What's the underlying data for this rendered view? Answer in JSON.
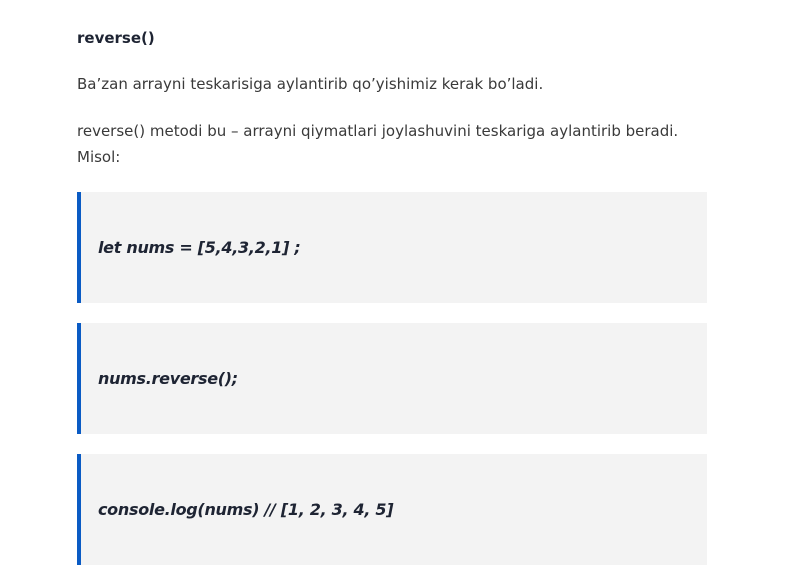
{
  "article": {
    "heading": "reverse()",
    "paragraph_1": "Ba’zan arrayni teskarisiga aylantirib qo’yishimiz kerak bo’ladi.",
    "paragraph_2": "reverse() metodi bu – arrayni qiymatlari joylashuvini teskariga aylantirib beradi. Misol:",
    "code_blocks": [
      "let nums = [5,4,3,2,1] ;",
      "nums.reverse();",
      "console.log(nums) // [1, 2, 3, 4, 5]"
    ]
  },
  "colors": {
    "accent_border": "#0a5bc4",
    "block_background": "#f3f3f3",
    "heading_text": "#1e2433",
    "body_text": "#3a3a3a"
  }
}
